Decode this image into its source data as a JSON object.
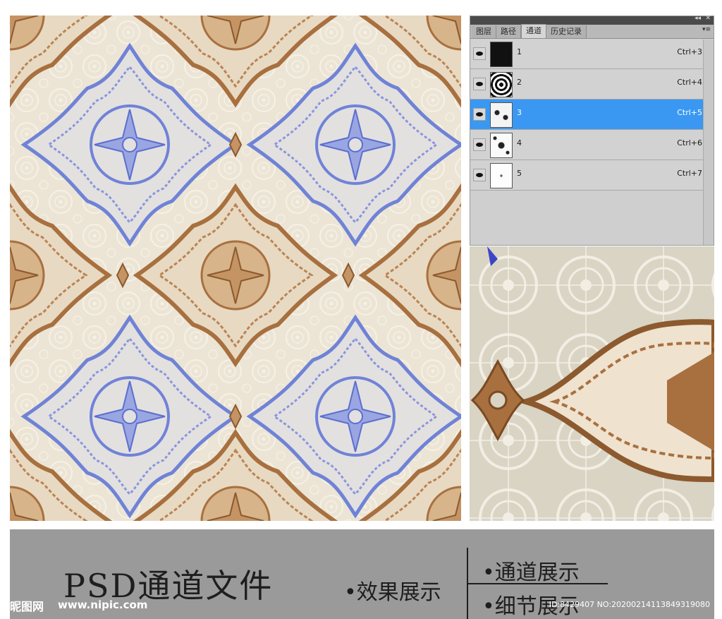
{
  "channels_panel": {
    "tabs": [
      {
        "label": "图层",
        "active": false
      },
      {
        "label": "路径",
        "active": false
      },
      {
        "label": "通道",
        "active": true
      },
      {
        "label": "历史记录",
        "active": false
      }
    ],
    "collapse_icon": "double-chevron-icon",
    "menu_icon": "panel-menu-icon",
    "rows": [
      {
        "name": "1",
        "shortcut": "Ctrl+3",
        "selected": false,
        "visible": true,
        "thumb": "black"
      },
      {
        "name": "2",
        "shortcut": "Ctrl+4",
        "selected": false,
        "visible": true,
        "thumb": "pattern-dense"
      },
      {
        "name": "3",
        "shortcut": "Ctrl+5",
        "selected": true,
        "visible": true,
        "thumb": "pattern-light"
      },
      {
        "name": "4",
        "shortcut": "Ctrl+6",
        "selected": false,
        "visible": true,
        "thumb": "pattern-sparse"
      },
      {
        "name": "5",
        "shortcut": "Ctrl+7",
        "selected": false,
        "visible": true,
        "thumb": "white"
      }
    ],
    "selected_color": "#3a98f2"
  },
  "colors": {
    "background": "#ece5d6",
    "blue_motif": "#6f83d6",
    "brown_motif": "#a8703f",
    "footer": "#9a9a9a"
  },
  "footer": {
    "title": "PSD通道文件",
    "effect_label": "•效果展示",
    "channel_label": "•通道展示",
    "detail_label": "•细节展示"
  },
  "watermark": {
    "logo": "昵图网",
    "url": "www.nipic.com",
    "id": "ID:8429407 NO:20200214113849319080"
  }
}
